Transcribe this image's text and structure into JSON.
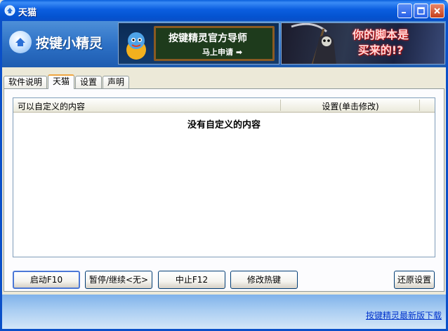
{
  "window": {
    "title": "天猫"
  },
  "header": {
    "logo_text": "按键小精灵",
    "banner1": {
      "title": "按键精灵官方导师",
      "subtitle": "马上申请 ➡"
    },
    "banner2": {
      "line1": "你的脚本是",
      "line2": "买来的!?"
    }
  },
  "tabs": [
    {
      "label": "软件说明",
      "active": false
    },
    {
      "label": "天猫",
      "active": true
    },
    {
      "label": "设置",
      "active": false
    },
    {
      "label": "声明",
      "active": false
    }
  ],
  "list": {
    "columns": [
      "可以自定义的内容",
      "设置(单击修改)"
    ],
    "empty_message": "没有自定义的内容"
  },
  "buttons": {
    "start": "启动F10",
    "pause": "暂停/继续<无>",
    "stop": "中止F12",
    "hotkey": "修改热键",
    "restore": "还原设置"
  },
  "footer": {
    "link": "按键精灵最新版下载"
  },
  "colors": {
    "titlebar": "#0a5fdc",
    "header": "#2c6fc4",
    "tab_active_accent": "#f0a640",
    "link": "#0033cc"
  }
}
